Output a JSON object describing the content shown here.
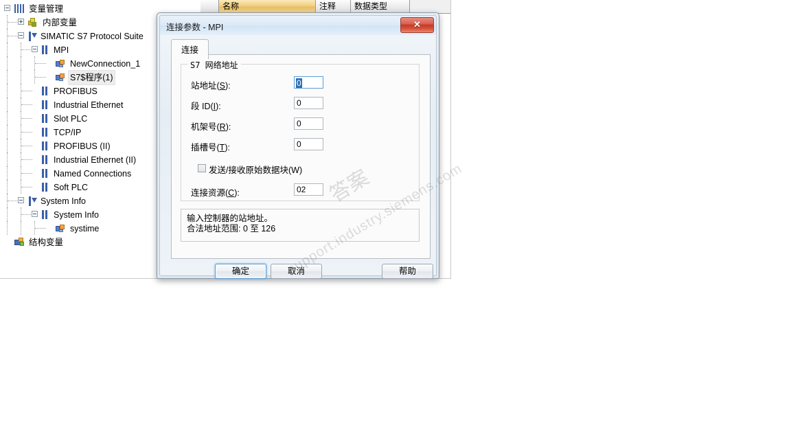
{
  "background": {
    "columns": [
      {
        "label": "名称",
        "selected": true
      },
      {
        "label": "注释",
        "selected": false
      },
      {
        "label": "数据类型",
        "selected": false
      }
    ],
    "tree": [
      {
        "label": "变量管理",
        "depth": 0,
        "icon": "bars4-icon",
        "expander": "minus",
        "highlight": false
      },
      {
        "label": "内部变量",
        "depth": 1,
        "icon": "cube-icon",
        "expander": "plus",
        "highlight": false
      },
      {
        "label": "SIMATIC S7 Protocol Suite",
        "depth": 1,
        "icon": "bar-arrow-icon",
        "expander": "minus",
        "highlight": false
      },
      {
        "label": "MPI",
        "depth": 2,
        "icon": "bars2-icon",
        "expander": "minus",
        "highlight": false
      },
      {
        "label": "NewConnection_1",
        "depth": 3,
        "icon": "plug-icon",
        "expander": "none",
        "highlight": false
      },
      {
        "label": "S7$程序(1)",
        "depth": 3,
        "icon": "plug-icon",
        "expander": "none",
        "highlight": true
      },
      {
        "label": "PROFIBUS",
        "depth": 2,
        "icon": "bars2-icon",
        "expander": "none",
        "highlight": false
      },
      {
        "label": "Industrial Ethernet",
        "depth": 2,
        "icon": "bars2-icon",
        "expander": "none",
        "highlight": false
      },
      {
        "label": "Slot PLC",
        "depth": 2,
        "icon": "bars2-icon",
        "expander": "none",
        "highlight": false
      },
      {
        "label": "TCP/IP",
        "depth": 2,
        "icon": "bars2-icon",
        "expander": "none",
        "highlight": false
      },
      {
        "label": "PROFIBUS (II)",
        "depth": 2,
        "icon": "bars2-icon",
        "expander": "none",
        "highlight": false
      },
      {
        "label": "Industrial Ethernet (II)",
        "depth": 2,
        "icon": "bars2-icon",
        "expander": "none",
        "highlight": false
      },
      {
        "label": "Named Connections",
        "depth": 2,
        "icon": "bars2-icon",
        "expander": "none",
        "highlight": false
      },
      {
        "label": "Soft PLC",
        "depth": 2,
        "icon": "bars2-icon",
        "expander": "none",
        "highlight": false
      },
      {
        "label": "System Info",
        "depth": 1,
        "icon": "bar-arrow-icon",
        "expander": "minus",
        "highlight": false
      },
      {
        "label": "System Info",
        "depth": 2,
        "icon": "bars2-icon",
        "expander": "minus",
        "highlight": false
      },
      {
        "label": "systime",
        "depth": 3,
        "icon": "plug-icon",
        "expander": "none",
        "highlight": false
      },
      {
        "label": "结构变量",
        "depth": 0,
        "icon": "struct-icon",
        "expander": "none",
        "highlight": false
      }
    ]
  },
  "dialog": {
    "title": "连接参数 - MPI",
    "close_glyph": "✕",
    "tab_label": "连接",
    "group_legend": "S7 网络地址",
    "fields": [
      {
        "label_prefix": "站地址(",
        "mnemonic": "S",
        "label_suffix": "):",
        "value": "0",
        "focused": true
      },
      {
        "label_prefix": "段 ID(",
        "mnemonic": "I",
        "label_suffix": "):",
        "value": "0",
        "focused": false
      },
      {
        "label_prefix": "机架号(",
        "mnemonic": "R",
        "label_suffix": "):",
        "value": "0",
        "focused": false
      },
      {
        "label_prefix": "插槽号(",
        "mnemonic": "T",
        "label_suffix": "):",
        "value": "0",
        "focused": false
      }
    ],
    "checkbox": {
      "label_prefix": "发送/接收原始数据块(",
      "mnemonic": "W",
      "label_suffix": ")",
      "checked": false
    },
    "resource_field": {
      "label_prefix": "连接资源(",
      "mnemonic": "C",
      "label_suffix": "):",
      "value": "02"
    },
    "hint_line1": "输入控制器的站地址。",
    "hint_line2": "合法地址范围: 0 至 126",
    "buttons": {
      "ok": "确定",
      "cancel": "取消",
      "help": "帮助"
    }
  },
  "watermarks": {
    "chinese": "答案",
    "url": "support.industry.siemens.com"
  },
  "colors": {
    "accent_blue": "#3b5fa8",
    "selected_header": "#f2cf81",
    "close_red": "#c23a28",
    "focus_blue": "#2f6fb5"
  }
}
